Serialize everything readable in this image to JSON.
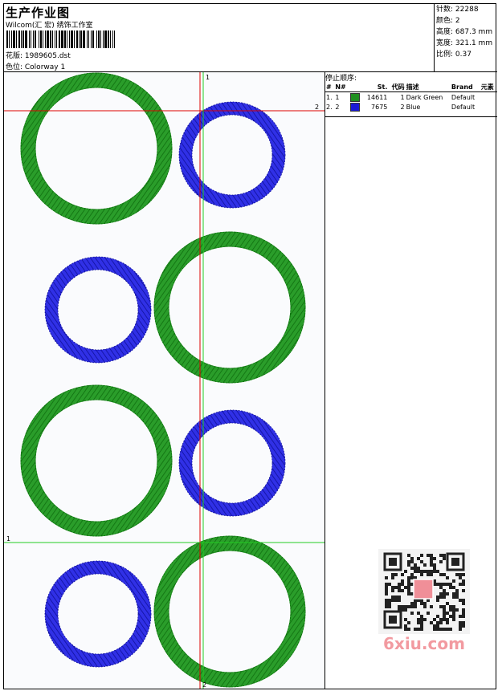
{
  "header": {
    "title": "生产作业图",
    "company": "Wilcom(汇 宏) 绣饰工作室",
    "file_line": "花版:  1989605.dst",
    "colorway_line": "色位:  Colorway 1"
  },
  "stats": [
    {
      "label": "针数",
      "value": "22288"
    },
    {
      "label": "颜色",
      "value": "2"
    },
    {
      "label": "高度",
      "value": "687.3 mm"
    },
    {
      "label": "宽度",
      "value": "321.1 mm"
    },
    {
      "label": "比例",
      "value": "0.37"
    }
  ],
  "sequence": {
    "title": "停止顺序:",
    "headers": [
      "#",
      "N#",
      "St.",
      "代码",
      "描述",
      "Brand",
      "元素"
    ],
    "rows": [
      {
        "num": "1.",
        "n": "1",
        "color": "#1f8f1f",
        "stitches": "14611",
        "code": "1",
        "desc": "Dark Green",
        "brand": "Default",
        "element": ""
      },
      {
        "num": "2.",
        "n": "2",
        "color": "#1a1ad6",
        "stitches": "7675",
        "code": "2",
        "desc": "Blue",
        "brand": "Default",
        "element": ""
      }
    ]
  },
  "design": {
    "green": "#229922",
    "blue": "#2222dd",
    "axis_red": "#dd0000",
    "axis_green": "#22cc22",
    "axis_labels": {
      "red_top": "2",
      "red_bottom": "2",
      "green_top": "1",
      "green_left": "1"
    }
  },
  "watermark": {
    "text": "6xiu.com",
    "seal": "汉绣图"
  }
}
